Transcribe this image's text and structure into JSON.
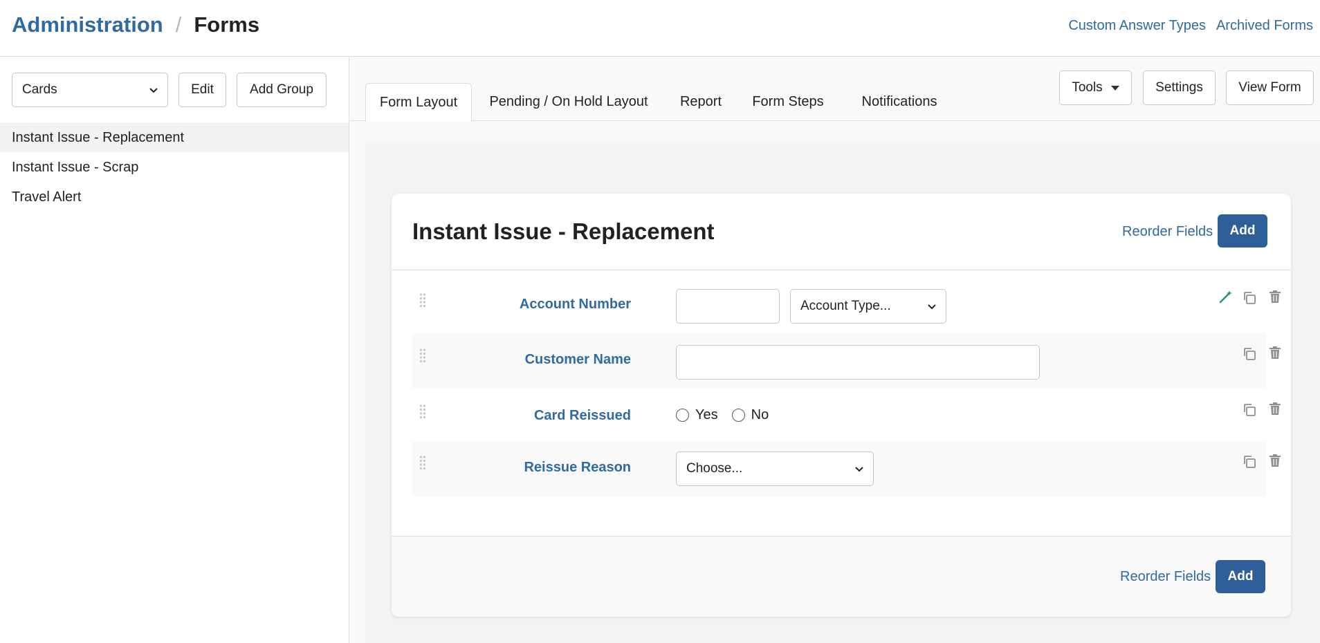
{
  "header": {
    "breadcrumb_root": "Administration",
    "breadcrumb_separator": "/",
    "breadcrumb_current": "Forms",
    "links": {
      "custom_answer_types": "Custom Answer Types",
      "archived_forms": "Archived Forms"
    }
  },
  "sidebar": {
    "group_select": {
      "value": "Cards"
    },
    "edit_label": "Edit",
    "add_group_label": "Add Group",
    "items": [
      {
        "label": "Instant Issue - Replacement",
        "active": true
      },
      {
        "label": "Instant Issue - Scrap",
        "active": false
      },
      {
        "label": "Travel Alert",
        "active": false
      }
    ]
  },
  "tabs": [
    {
      "label": "Form Layout",
      "active": true
    },
    {
      "label": "Pending / On Hold Layout",
      "active": false
    },
    {
      "label": "Report",
      "active": false
    },
    {
      "label": "Form Steps",
      "active": false
    },
    {
      "label": "Notifications",
      "active": false
    }
  ],
  "toolbar": {
    "tools_label": "Tools",
    "settings_label": "Settings",
    "view_form_label": "View Form"
  },
  "card": {
    "title": "Instant Issue - Replacement",
    "reorder_label": "Reorder Fields",
    "add_label": "Add",
    "fields": [
      {
        "label": "Account Number",
        "account_type_select": "Account Type..."
      },
      {
        "label": "Customer Name"
      },
      {
        "label": "Card Reissued",
        "options": [
          "Yes",
          "No"
        ]
      },
      {
        "label": "Reissue Reason",
        "select_value": "Choose..."
      }
    ]
  },
  "colors": {
    "link": "#2f6aa0",
    "primary": "#2f5f99",
    "wand": "#1e9b62"
  }
}
